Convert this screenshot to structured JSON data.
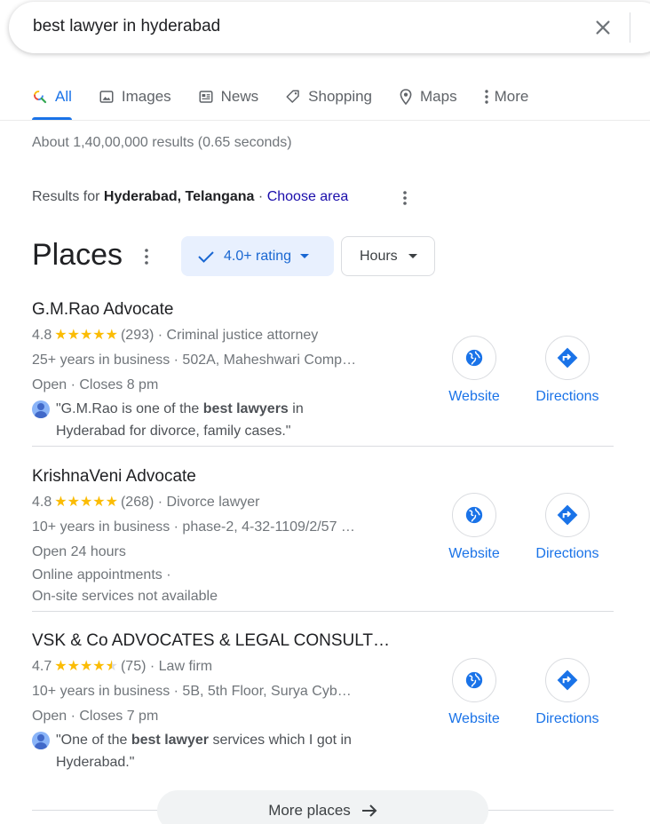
{
  "search": {
    "query": "best lawyer in hyderabad"
  },
  "tabs": [
    {
      "label": "All",
      "icon": "search-multicolor-icon",
      "active": true
    },
    {
      "label": "Images",
      "icon": "image-icon"
    },
    {
      "label": "News",
      "icon": "news-icon"
    },
    {
      "label": "Shopping",
      "icon": "tag-icon"
    },
    {
      "label": "Maps",
      "icon": "map-pin-icon"
    },
    {
      "label": "More",
      "icon": "more-vert-icon"
    }
  ],
  "stats": "About 1,40,00,000 results (0.65 seconds)",
  "location": {
    "prefix": "Results for",
    "place": "Hyderabad, Telangana",
    "separator": "·",
    "choose": "Choose area"
  },
  "places": {
    "title": "Places",
    "filters": {
      "rating": "4.0+ rating",
      "hours": "Hours"
    },
    "items": [
      {
        "name": "G.M.Rao Advocate",
        "rating": "4.8",
        "stars": 5,
        "reviews": "(293)",
        "category": "· Criminal justice attorney",
        "details": "25+ years in business · 502A, Maheshwari Comp…",
        "hours": "Open · Closes 8 pm",
        "review_pre": "\"G.M.Rao is one of the ",
        "review_bold": "best lawyers",
        "review_post": " in Hyderabad for divorce, family cases.\""
      },
      {
        "name": "KrishnaVeni Advocate",
        "rating": "4.8",
        "stars": 5,
        "reviews": "(268)",
        "category": "· Divorce lawyer",
        "details": "10+ years in business · phase-2, 4-32-1109/2/57 …",
        "hours": "Open 24 hours",
        "extra1": "Online appointments ·",
        "extra2": "On-site services not available"
      },
      {
        "name": "VSK & Co ADVOCATES & LEGAL CONSULT…",
        "rating": "4.7",
        "stars": 4.5,
        "reviews": "(75)",
        "category": "· Law firm",
        "details": "10+ years in business · 5B, 5th Floor, Surya Cyb…",
        "hours": "Open · Closes 7 pm",
        "review_pre": "\"One of the ",
        "review_bold": "best lawyer",
        "review_post": " services which I got in Hyderabad.\""
      }
    ],
    "actions": {
      "website": "Website",
      "directions": "Directions"
    },
    "more": "More places"
  },
  "colors": {
    "accent": "#1a73e8",
    "star": "#fbbc04",
    "link": "#1a0dab"
  }
}
